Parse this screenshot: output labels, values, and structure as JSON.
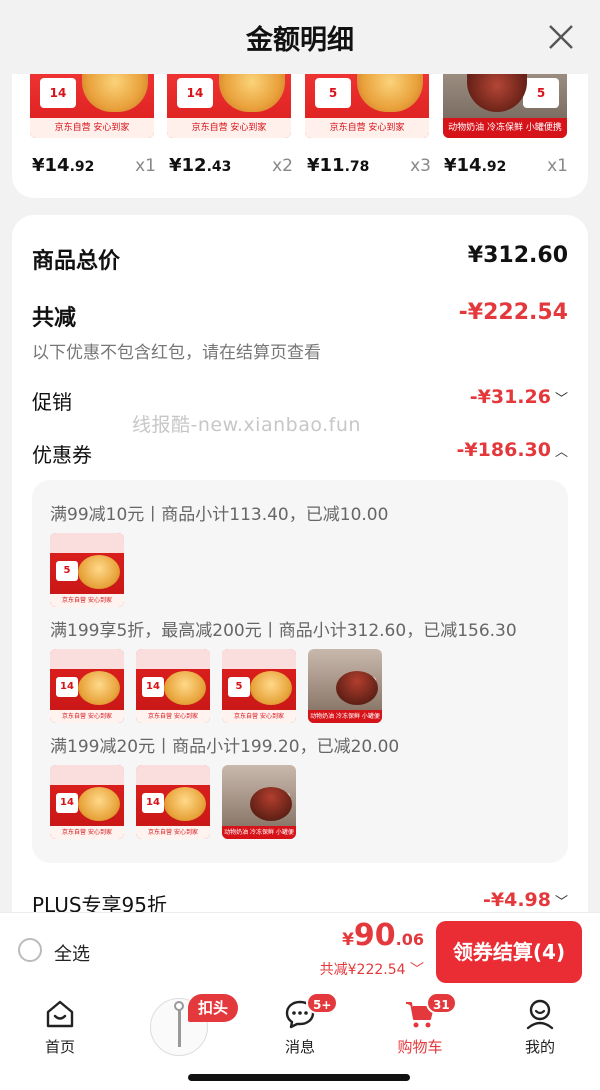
{
  "header": {
    "title": "金额明细"
  },
  "products": [
    {
      "yen": "¥",
      "int": "14",
      "dec": ".92",
      "qty": "x1",
      "tag": "14",
      "strip": "京东自营 安心到家"
    },
    {
      "yen": "¥",
      "int": "12",
      "dec": ".43",
      "qty": "x2",
      "tag": "14",
      "strip": "京东自营 安心到家"
    },
    {
      "yen": "¥",
      "int": "11",
      "dec": ".78",
      "qty": "x3",
      "tag": "5",
      "strip": "京东自营 安心到家"
    },
    {
      "yen": "¥",
      "int": "14",
      "dec": ".92",
      "qty": "x1",
      "tag": "5",
      "strip": "动物奶油 冷冻保鲜 小罐便携"
    }
  ],
  "breakdown": {
    "total_label": "商品总价",
    "total_amount": "¥312.60",
    "reduce_label": "共减",
    "reduce_amount": "-¥222.54",
    "note": "以下优惠不包含红包，请在结算页查看",
    "promo_label": "促销",
    "promo_amount": "-¥31.26",
    "coupon_label": "优惠券",
    "coupon_amount": "-¥186.30",
    "plus_label": "PLUS专享95折",
    "plus_amount": "-¥4.98"
  },
  "coupons": [
    {
      "text": "满99减10元丨商品小计113.40，已减10.00"
    },
    {
      "text": "满199享5折，最高减200元丨商品小计312.60，已减156.30"
    },
    {
      "text": "满199减20元丨商品小计199.20，已减20.00"
    }
  ],
  "watermark": "线报酷-new.xianbao.fun",
  "checkout": {
    "select_all": "全选",
    "yen": "¥",
    "price_int": "90",
    "price_dec": ".06",
    "saved": "共减¥222.54",
    "pay_button": "领券结算(4)"
  },
  "tabs": {
    "home": "首页",
    "pin_badge": "扣头",
    "messages": "消息",
    "messages_badge": "5+",
    "cart": "购物车",
    "cart_badge": "31",
    "me": "我的"
  },
  "colors": {
    "accent": "#e4393c",
    "button": "#ea2d34",
    "bg": "#f2f2f2"
  }
}
